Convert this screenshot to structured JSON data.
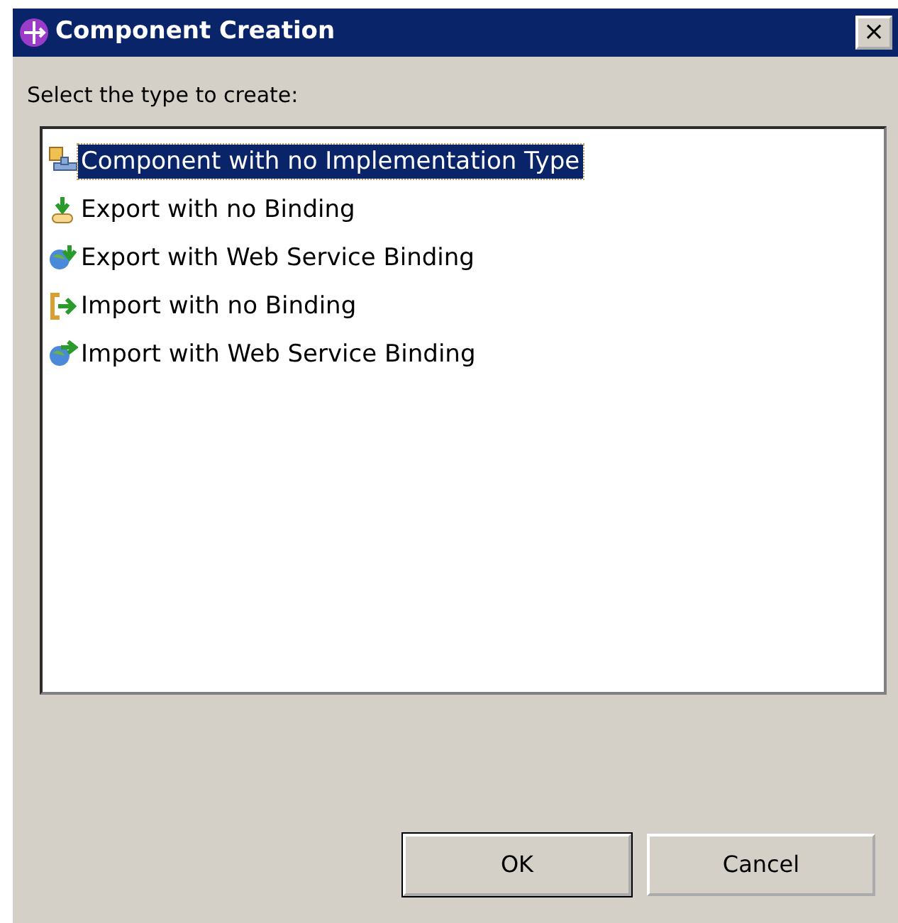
{
  "window": {
    "title": "Component Creation",
    "close_label": "×"
  },
  "prompt": "Select the type to create:",
  "types": [
    {
      "label": "Component with no Implementation Type",
      "kind": "component",
      "selected": true
    },
    {
      "label": "Export with no Binding",
      "kind": "export",
      "selected": false
    },
    {
      "label": "Export with Web Service Binding",
      "kind": "export-ws",
      "selected": false
    },
    {
      "label": "Import with no Binding",
      "kind": "import",
      "selected": false
    },
    {
      "label": "Import with Web Service Binding",
      "kind": "import-ws",
      "selected": false
    }
  ],
  "buttons": [
    {
      "label": "OK",
      "default": true
    },
    {
      "label": "Cancel",
      "default": false
    }
  ]
}
